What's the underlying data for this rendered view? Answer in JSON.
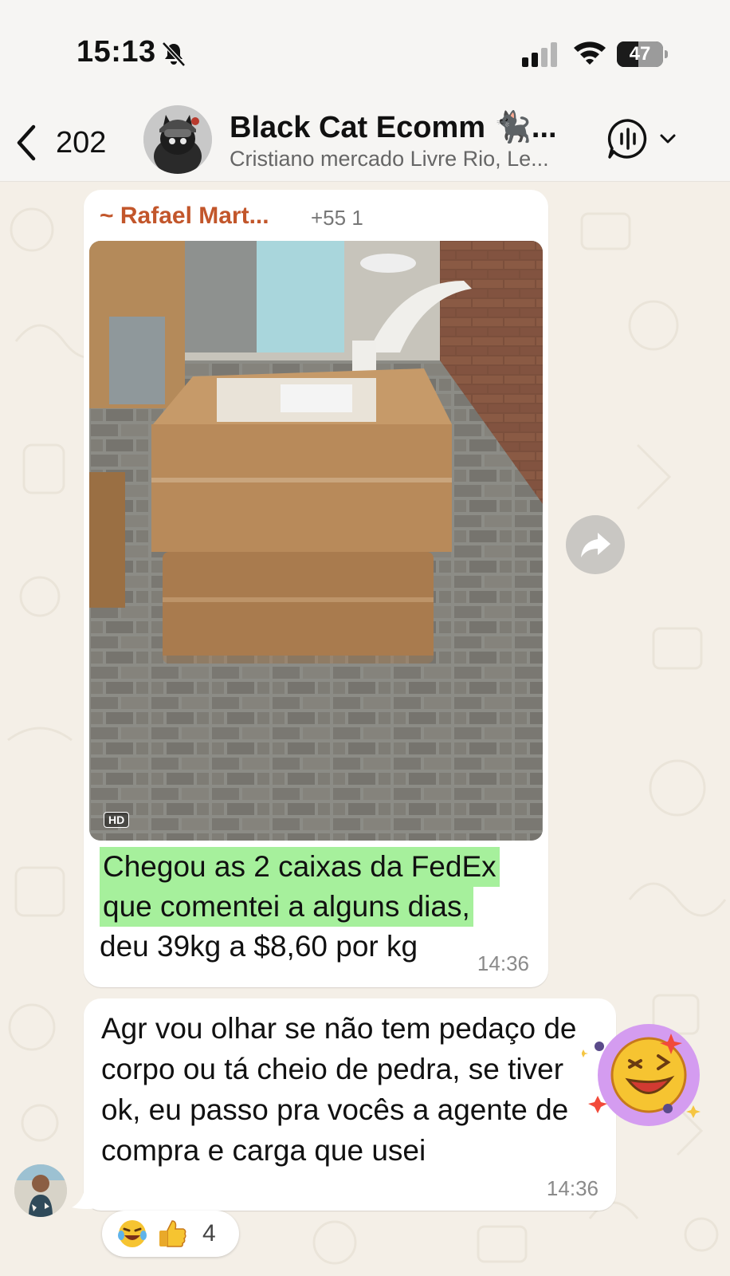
{
  "status_bar": {
    "time": "15:13",
    "battery": "47",
    "battery_level": 0.47
  },
  "header": {
    "back_count": "202",
    "group_name": "Black Cat Ecomm 🐈‍⬛...",
    "group_subtitle": "Cristiano mercado Livre Rio, Le..."
  },
  "messages": [
    {
      "sender": "~ Rafael Mart...",
      "sender_phone": "+55 1",
      "media_badge": "HD",
      "caption_highlighted": [
        "Chegou as 2 caixas da FedEx",
        "que comentei a alguns dias,"
      ],
      "caption_plain": "deu 39kg a $8,60 por kg",
      "time": "14:36"
    },
    {
      "text": "Agr vou olhar se não tem pedaço de corpo ou tá cheio de pedra, se tiver ok, eu passo pra vocês a agente de compra e carga que usei",
      "time": "14:36",
      "reactions": {
        "emojis": [
          "face-with-tears-of-joy",
          "thumbs-up"
        ],
        "count": "4"
      }
    }
  ],
  "colors": {
    "sender": "#c2562b",
    "highlight": "#a6f09c",
    "chat_bg": "#f4efe7"
  }
}
